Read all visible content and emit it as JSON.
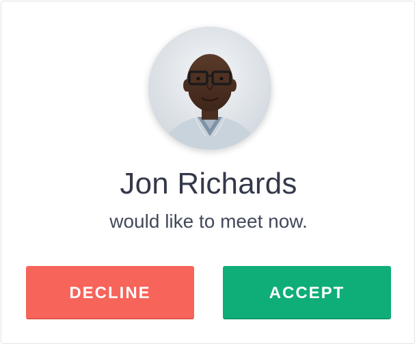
{
  "caller": {
    "name": "Jon Richards",
    "message": "would like to meet now."
  },
  "actions": {
    "decline_label": "DECLINE",
    "accept_label": "ACCEPT"
  },
  "colors": {
    "decline": "#f6645a",
    "accept": "#0fae78",
    "name_text": "#33394a",
    "message_text": "#414859",
    "card_border": "#dfe3e8"
  },
  "icons": {
    "avatar": "person-photo"
  }
}
